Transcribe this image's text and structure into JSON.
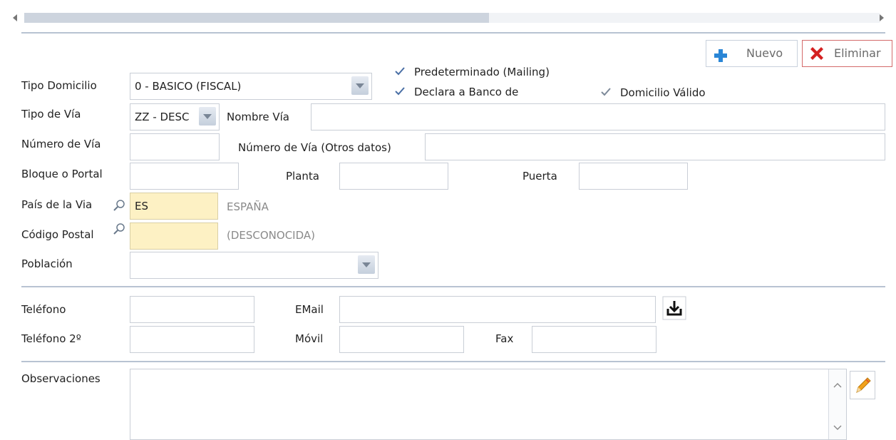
{
  "toolbar": {
    "nuevo": "Nuevo",
    "eliminar": "Eliminar"
  },
  "checks": {
    "predeterminado": "Predeterminado (Mailing)",
    "declara": "Declara a Banco de",
    "domicilio_valido": "Domicilio Válido"
  },
  "labels": {
    "tipo_domicilio": "Tipo Domicilio",
    "tipo_via": "Tipo de Vía",
    "nombre_via": "Nombre Vía",
    "numero_via": "Número de Vía",
    "numero_via_otros": "Número de Vía (Otros datos)",
    "bloque": "Bloque o Portal",
    "planta": "Planta",
    "puerta": "Puerta",
    "pais": "País de la Via",
    "codigo_postal": "Código Postal",
    "poblacion": "Población",
    "telefono": "Teléfono",
    "email": "EMail",
    "telefono2": "Teléfono 2º",
    "movil": "Móvil",
    "fax": "Fax",
    "observaciones": "Observaciones"
  },
  "values": {
    "tipo_domicilio": "0 - BASICO (FISCAL)",
    "tipo_via": "ZZ - DESC",
    "pais_code": "ES",
    "pais_name": "ESPAÑA",
    "codigo_postal_name": "(DESCONOCIDA)"
  },
  "icons": {
    "add": "plus-icon",
    "delete": "red-x-icon",
    "lookup": "magnifier-icon",
    "download": "download-icon",
    "edit": "pencil-icon"
  },
  "colors": {
    "accent_blue": "#2a86d6",
    "delete_red": "#d42020",
    "lookup_yellow": "#fdf1c4",
    "separator": "#b8c3d2"
  }
}
